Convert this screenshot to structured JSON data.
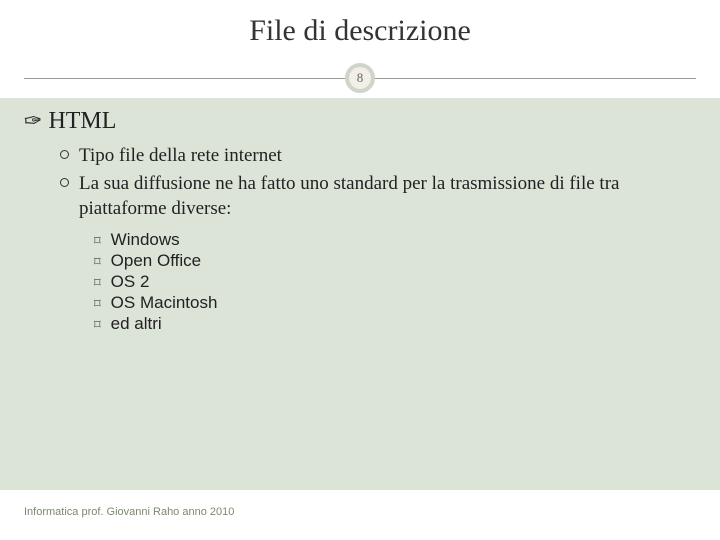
{
  "title": "File di descrizione",
  "page_number": "8",
  "heading": "HTML",
  "points": [
    "Tipo file della rete internet",
    "La sua diffusione ne ha fatto uno standard per la trasmissione di file tra piattaforme diverse:"
  ],
  "subitems": [
    "Windows",
    "Open Office",
    "OS 2",
    "OS Macintosh",
    "ed altri"
  ],
  "footer": "Informatica prof. Giovanni Raho anno 2010"
}
